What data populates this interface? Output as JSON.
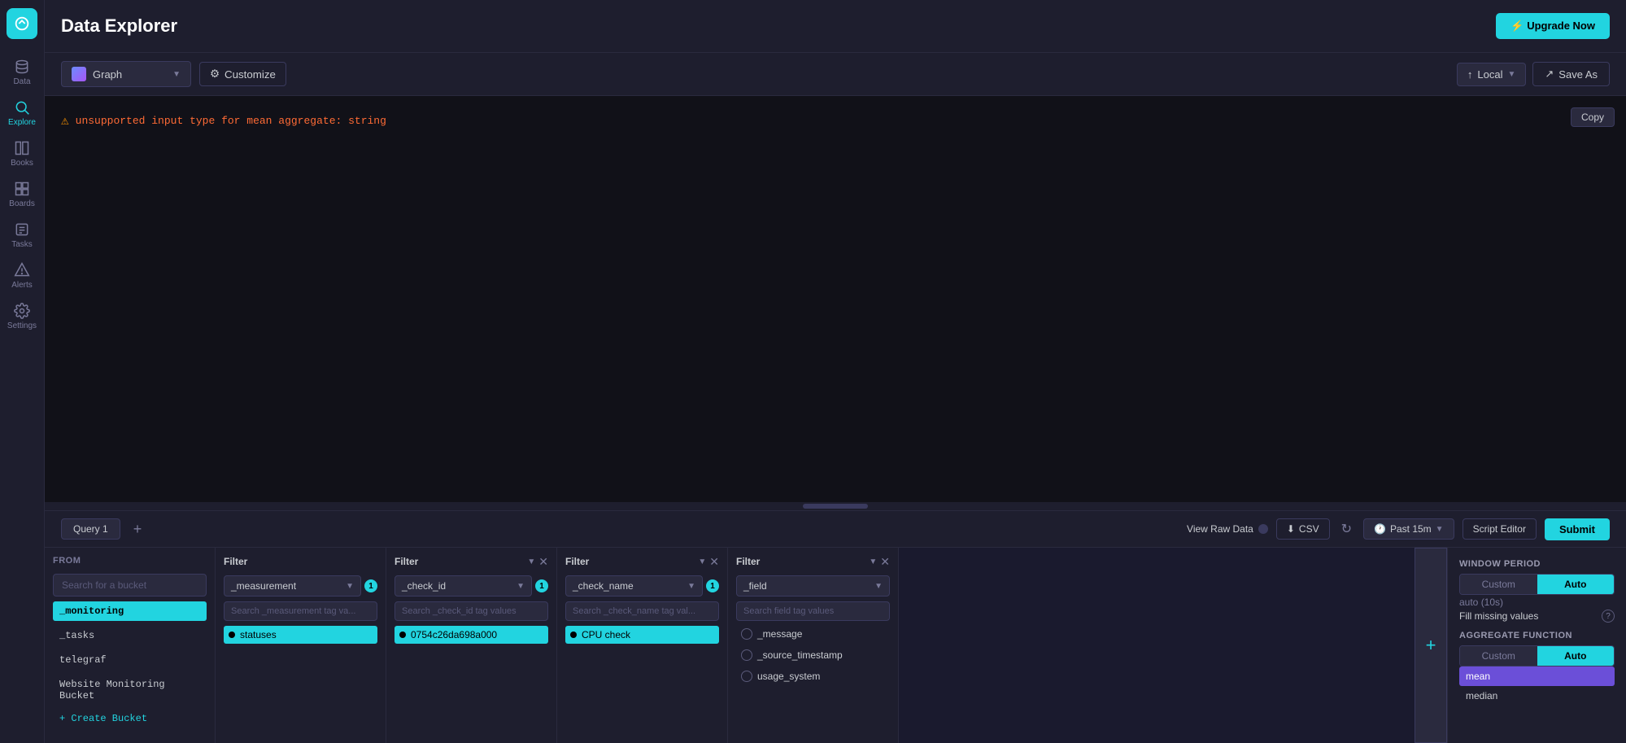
{
  "app": {
    "title": "Data Explorer",
    "upgrade_label": "⚡ Upgrade Now"
  },
  "toolbar": {
    "graph_label": "Graph",
    "customize_label": "Customize",
    "local_label": "Local",
    "save_as_label": "Save As"
  },
  "chart": {
    "error_text": "unsupported input type for mean aggregate: string",
    "copy_label": "Copy"
  },
  "query_bar": {
    "query_tab_label": "Query 1",
    "view_raw_label": "View Raw Data",
    "csv_label": "CSV",
    "time_range_label": "Past 15m",
    "script_editor_label": "Script Editor",
    "submit_label": "Submit"
  },
  "from_panel": {
    "label": "FROM",
    "search_placeholder": "Search for a bucket",
    "buckets": [
      {
        "name": "_monitoring",
        "active": true
      },
      {
        "name": "_tasks",
        "active": false
      },
      {
        "name": "telegraf",
        "active": false
      },
      {
        "name": "Website Monitoring Bucket",
        "active": false
      }
    ],
    "create_label": "+ Create Bucket"
  },
  "filter_panels": [
    {
      "id": "filter1",
      "label": "Filter",
      "field": "_measurement",
      "badge": "1",
      "search_placeholder": "Search _measurement tag va...",
      "values": [
        {
          "name": "statuses",
          "selected": true
        }
      ],
      "has_close": false
    },
    {
      "id": "filter2",
      "label": "Filter",
      "field": "_check_id",
      "badge": "1",
      "search_placeholder": "Search _check_id tag values",
      "values": [
        {
          "name": "0754c26da698a000",
          "selected": true
        }
      ],
      "has_close": true
    },
    {
      "id": "filter3",
      "label": "Filter",
      "field": "_check_name",
      "badge": "1",
      "search_placeholder": "Search _check_name tag val...",
      "values": [
        {
          "name": "CPU check",
          "selected": true
        }
      ],
      "has_close": true
    },
    {
      "id": "filter4",
      "label": "Filter",
      "field": "_field",
      "badge": "0",
      "search_placeholder": "Search field tag values",
      "values": [
        {
          "name": "_message",
          "selected": false
        },
        {
          "name": "_source_timestamp",
          "selected": false
        },
        {
          "name": "usage_system",
          "selected": false
        }
      ],
      "has_close": true
    }
  ],
  "right_panel": {
    "window_period_title": "WINDOW PERIOD",
    "custom_label": "Custom",
    "auto_label": "Auto",
    "auto_text": "auto (10s)",
    "fill_missing_label": "Fill missing values",
    "aggregate_title": "AGGREGATE FUNCTION",
    "custom2_label": "Custom",
    "auto2_label": "Auto",
    "agg_functions": [
      {
        "name": "mean",
        "active": true
      },
      {
        "name": "median",
        "active": false
      }
    ]
  },
  "sidebar": {
    "logo_alt": "InfluxDB",
    "items": [
      {
        "label": "Data",
        "icon": "data-icon"
      },
      {
        "label": "Explore",
        "icon": "explore-icon",
        "active": true
      },
      {
        "label": "Books",
        "icon": "books-icon"
      },
      {
        "label": "Boards",
        "icon": "boards-icon"
      },
      {
        "label": "Tasks",
        "icon": "tasks-icon"
      },
      {
        "label": "Alerts",
        "icon": "alerts-icon"
      },
      {
        "label": "Settings",
        "icon": "settings-icon"
      }
    ]
  }
}
